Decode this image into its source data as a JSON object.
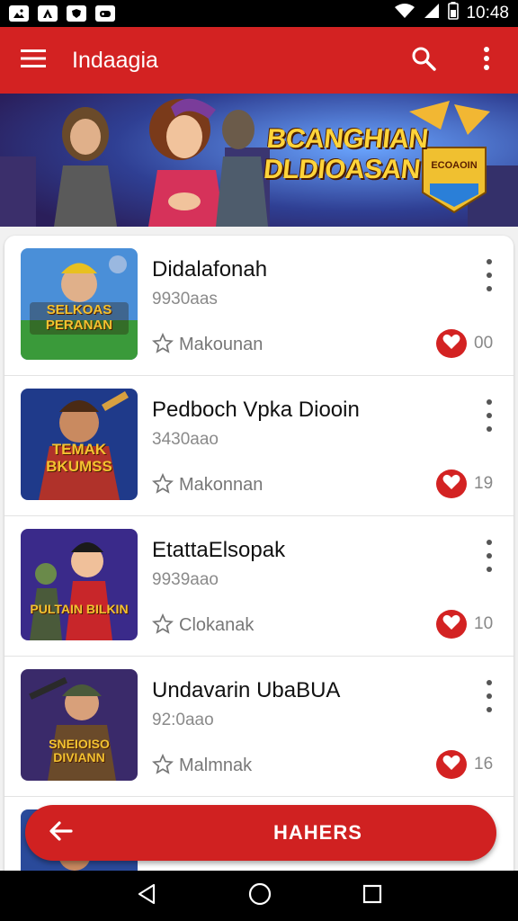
{
  "status_bar": {
    "time": "10:48",
    "left_icons": [
      "image-icon",
      "app-icon",
      "shield-icon",
      "game-icon"
    ],
    "right_icons": [
      "wifi-icon",
      "signal-icon",
      "battery-icon"
    ]
  },
  "app_bar": {
    "title": "Indaagia",
    "menu_icon": "hamburger-menu-icon",
    "search_icon": "search-icon",
    "more_icon": "more-vertical-icon"
  },
  "banner": {
    "title_line1": "BCANGHIAN",
    "title_line2": "DLDIOASAN",
    "badge_text": "ECOAOIN"
  },
  "list": {
    "items": [
      {
        "title": "Didalafonah",
        "subtitle": "9930aas",
        "tag": "Makounan",
        "count": "00",
        "thumb_text": "SELKOAS PERANAN"
      },
      {
        "title": "Pedboch Vpka Diooin",
        "subtitle": "3430aao",
        "tag": "Makonnan",
        "count": "19",
        "thumb_text": "TEMAK BKUMSS"
      },
      {
        "title": "EtattaElsopak",
        "subtitle": "9939aao",
        "tag": "Clokanak",
        "count": "10",
        "thumb_text": "PULTAIN BILKIN"
      },
      {
        "title": "Undavarin UbaBUA",
        "subtitle": "92:0aao",
        "tag": "Malmnak",
        "count": "16",
        "thumb_text": "SNEIOISO DIVIANN"
      }
    ]
  },
  "bottom_pill": {
    "label": "HAHERS",
    "back_icon": "arrow-left-icon"
  },
  "nav_bar": {
    "back_icon": "nav-back-icon",
    "home_icon": "nav-home-icon",
    "recents_icon": "nav-recents-icon"
  },
  "colors": {
    "primary": "#d32222",
    "heart": "#d32222",
    "text": "#111111",
    "muted": "#8a8a8a"
  }
}
